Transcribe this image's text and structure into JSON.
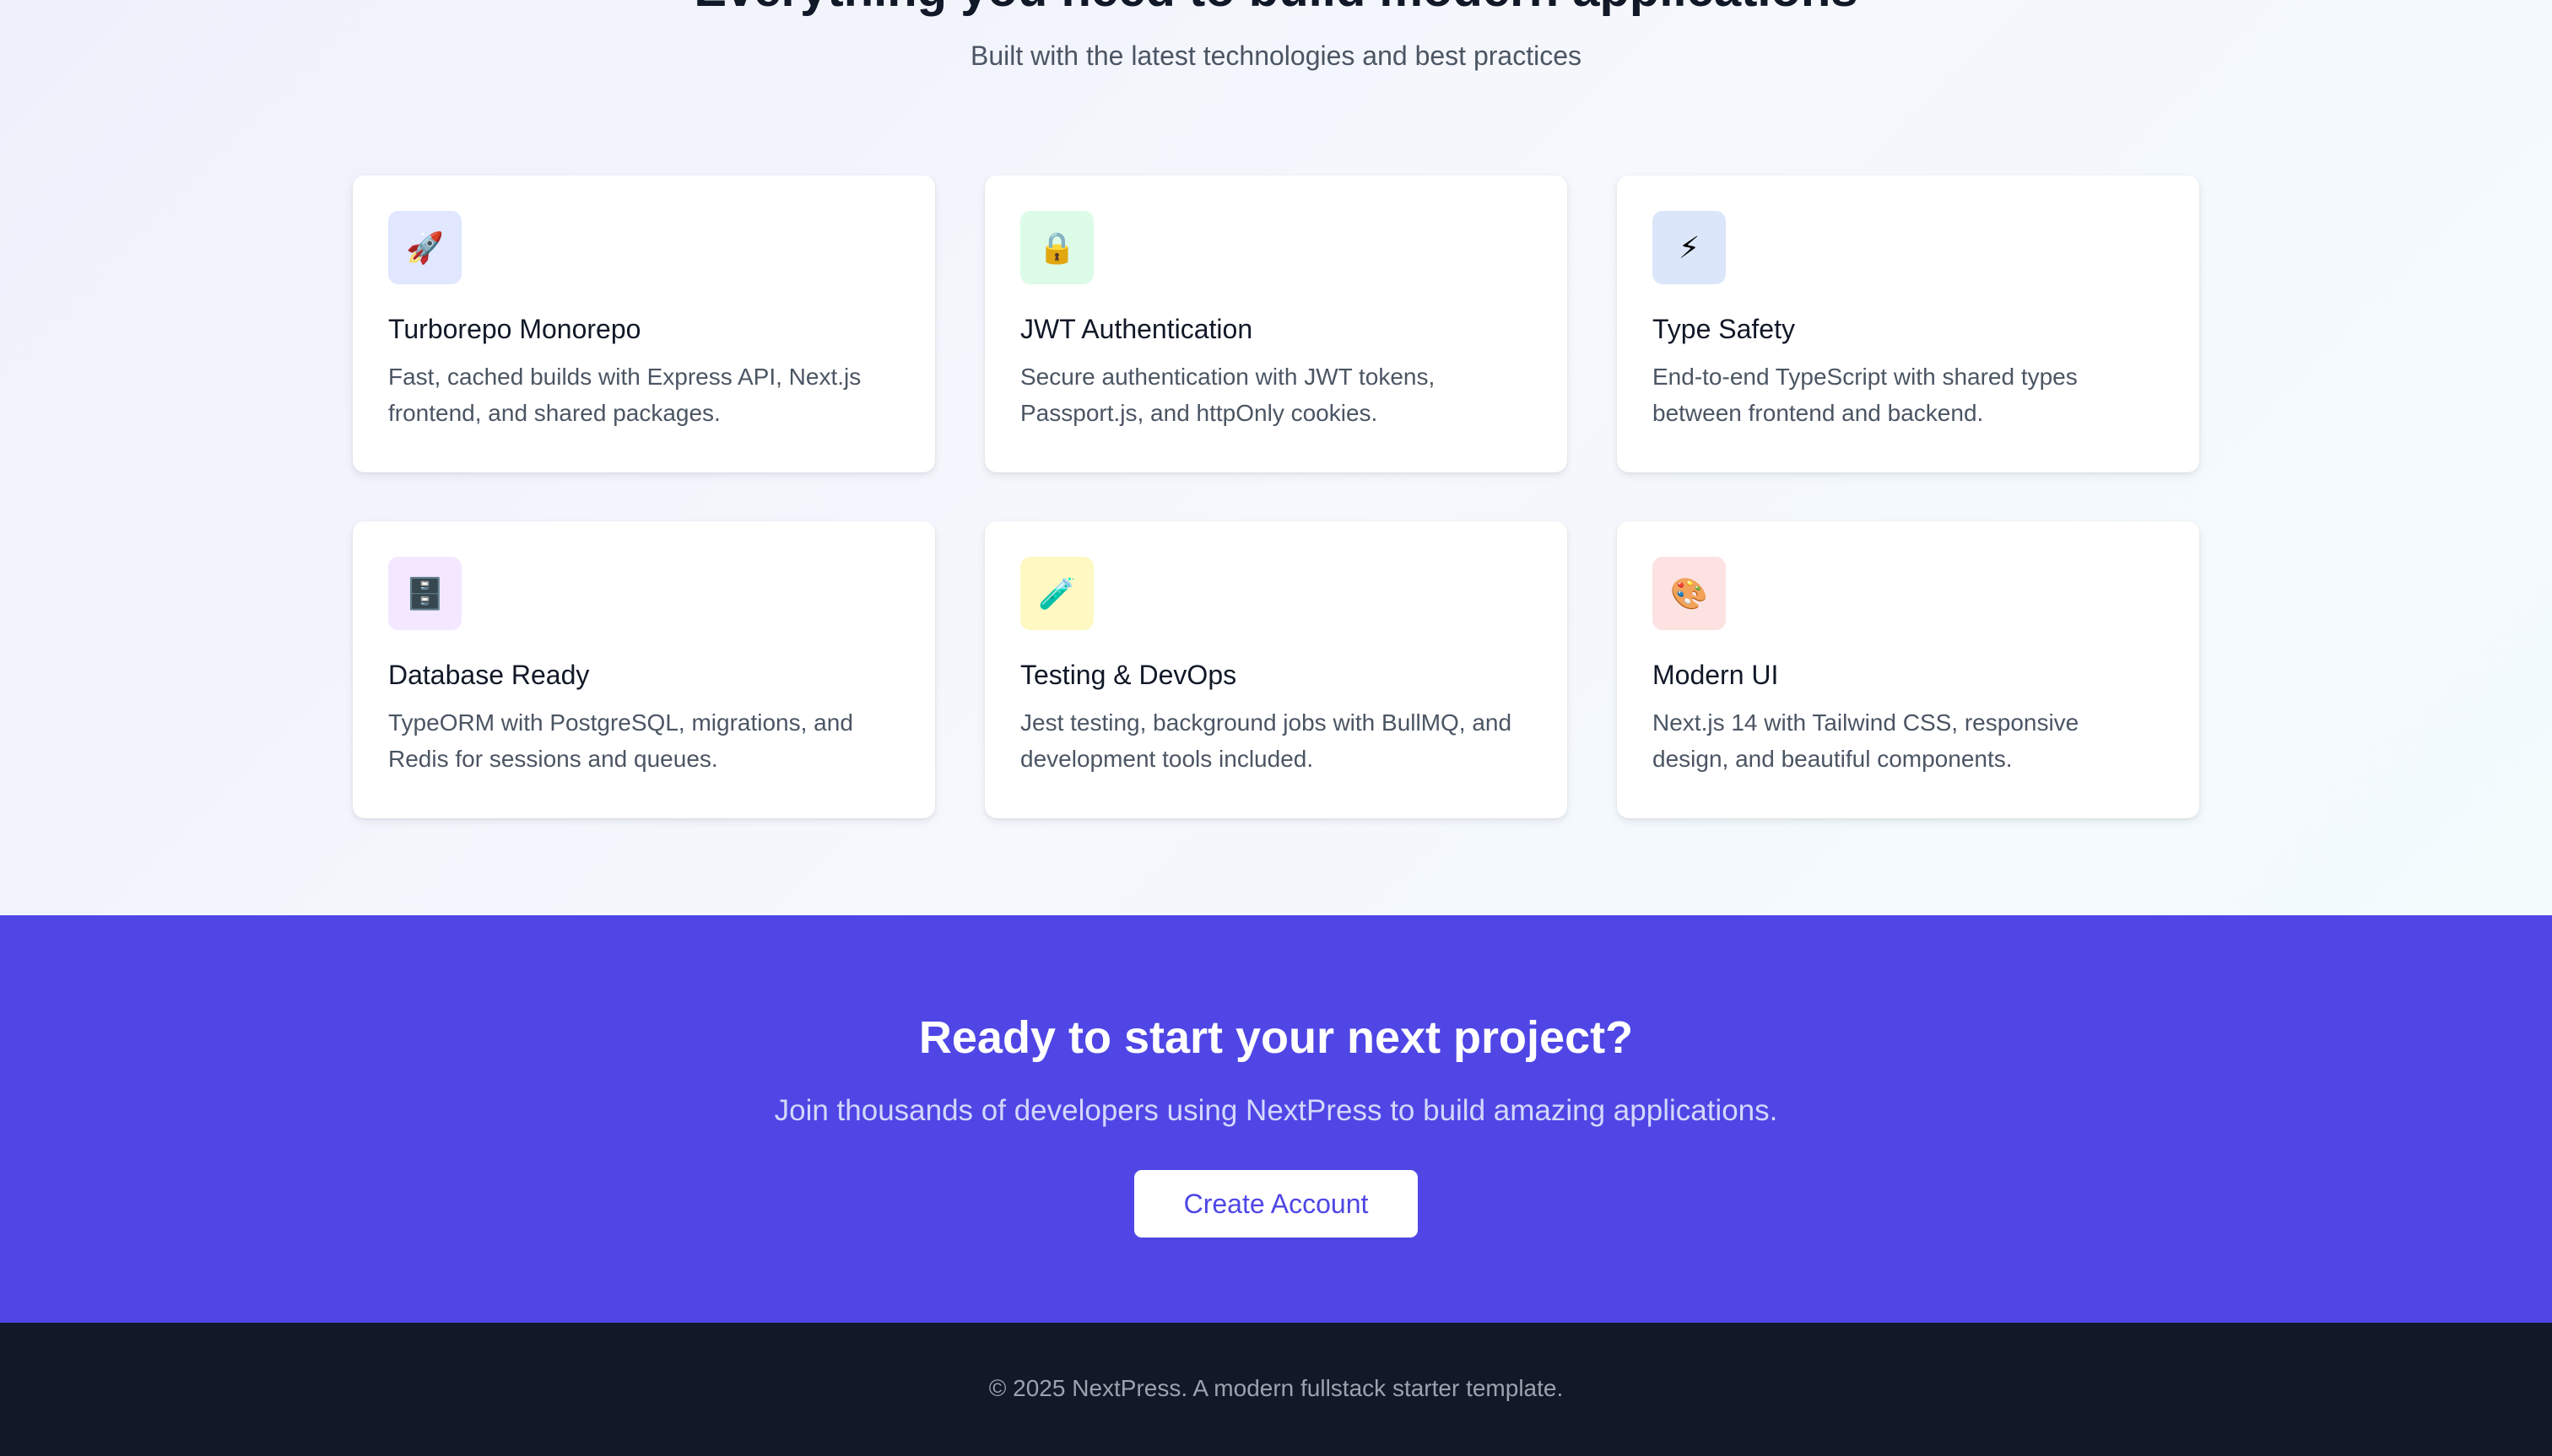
{
  "features_section": {
    "heading": "Everything you need to build modern applications",
    "subtitle": "Built with the latest technologies and best practices",
    "cards": [
      {
        "icon": "rocket-icon",
        "glyph": "🚀",
        "icon_bg": "#e0e7ff",
        "title": "Turborepo Monorepo",
        "description": "Fast, cached builds with Express API, Next.js frontend, and shared packages."
      },
      {
        "icon": "lock-icon",
        "glyph": "🔒",
        "icon_bg": "#dcfce7",
        "title": "JWT Authentication",
        "description": "Secure authentication with JWT tokens, Passport.js, and httpOnly cookies."
      },
      {
        "icon": "lightning-icon",
        "glyph": "⚡",
        "icon_bg": "#dbe6fb",
        "title": "Type Safety",
        "description": "End-to-end TypeScript with shared types between frontend and backend."
      },
      {
        "icon": "file-cabinet-icon",
        "glyph": "🗄️",
        "icon_bg": "#f3e8ff",
        "title": "Database Ready",
        "description": "TypeORM with PostgreSQL, migrations, and Redis for sessions and queues."
      },
      {
        "icon": "test-tube-icon",
        "glyph": "🧪",
        "icon_bg": "#fef9c3",
        "title": "Testing & DevOps",
        "description": "Jest testing, background jobs with BullMQ, and development tools included."
      },
      {
        "icon": "palette-icon",
        "glyph": "🎨",
        "icon_bg": "#fde2e2",
        "title": "Modern UI",
        "description": "Next.js 14 with Tailwind CSS, responsive design, and beautiful components."
      }
    ]
  },
  "cta": {
    "title": "Ready to start your next project?",
    "subtitle": "Join thousands of developers using NextPress to build amazing applications.",
    "button_label": "Create Account",
    "background": "#4f46e5"
  },
  "footer": {
    "text": "© 2025 NextPress. A modern fullstack starter template."
  }
}
